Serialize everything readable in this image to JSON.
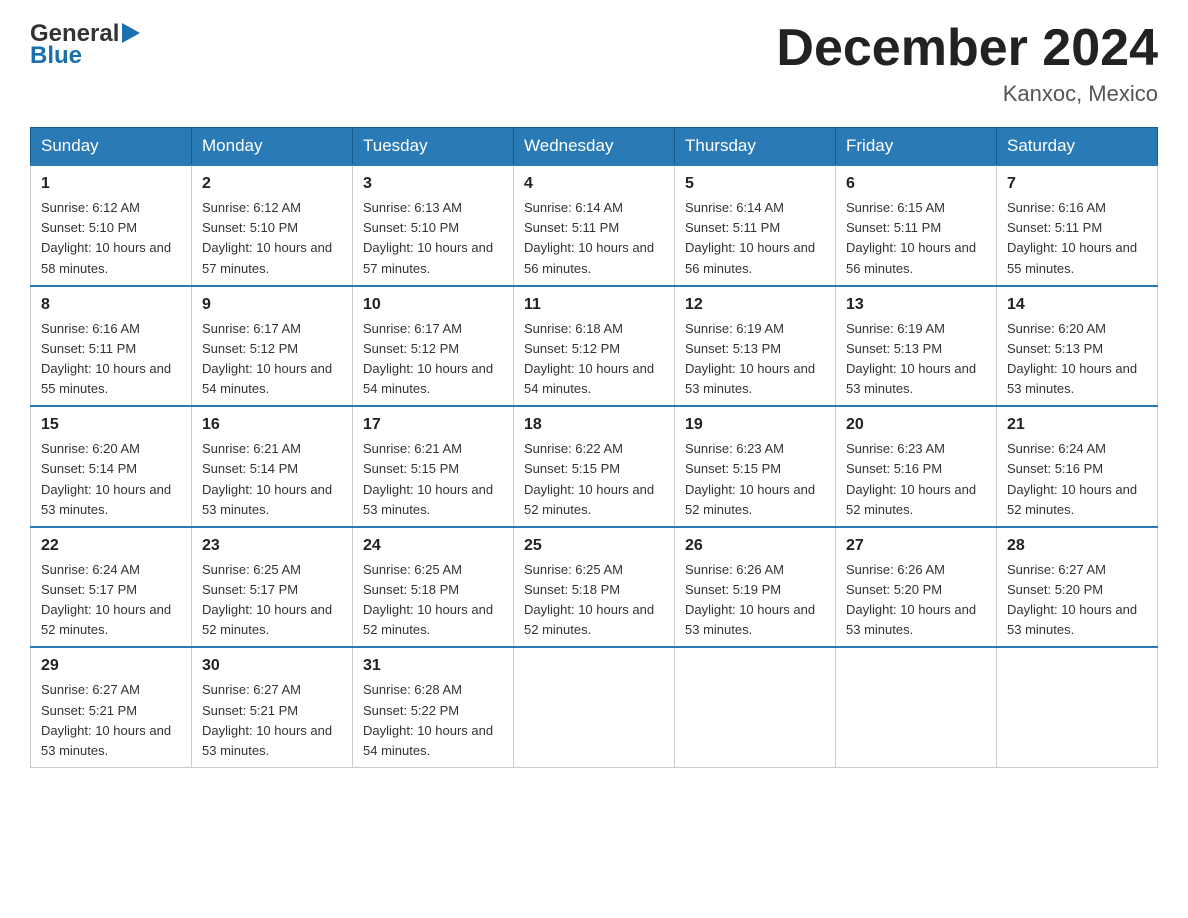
{
  "header": {
    "logo_general": "General",
    "logo_blue": "Blue",
    "month_title": "December 2024",
    "location": "Kanxoc, Mexico"
  },
  "days_of_week": [
    "Sunday",
    "Monday",
    "Tuesday",
    "Wednesday",
    "Thursday",
    "Friday",
    "Saturday"
  ],
  "weeks": [
    [
      {
        "day": "1",
        "sunrise": "6:12 AM",
        "sunset": "5:10 PM",
        "daylight": "10 hours and 58 minutes."
      },
      {
        "day": "2",
        "sunrise": "6:12 AM",
        "sunset": "5:10 PM",
        "daylight": "10 hours and 57 minutes."
      },
      {
        "day": "3",
        "sunrise": "6:13 AM",
        "sunset": "5:10 PM",
        "daylight": "10 hours and 57 minutes."
      },
      {
        "day": "4",
        "sunrise": "6:14 AM",
        "sunset": "5:11 PM",
        "daylight": "10 hours and 56 minutes."
      },
      {
        "day": "5",
        "sunrise": "6:14 AM",
        "sunset": "5:11 PM",
        "daylight": "10 hours and 56 minutes."
      },
      {
        "day": "6",
        "sunrise": "6:15 AM",
        "sunset": "5:11 PM",
        "daylight": "10 hours and 56 minutes."
      },
      {
        "day": "7",
        "sunrise": "6:16 AM",
        "sunset": "5:11 PM",
        "daylight": "10 hours and 55 minutes."
      }
    ],
    [
      {
        "day": "8",
        "sunrise": "6:16 AM",
        "sunset": "5:11 PM",
        "daylight": "10 hours and 55 minutes."
      },
      {
        "day": "9",
        "sunrise": "6:17 AM",
        "sunset": "5:12 PM",
        "daylight": "10 hours and 54 minutes."
      },
      {
        "day": "10",
        "sunrise": "6:17 AM",
        "sunset": "5:12 PM",
        "daylight": "10 hours and 54 minutes."
      },
      {
        "day": "11",
        "sunrise": "6:18 AM",
        "sunset": "5:12 PM",
        "daylight": "10 hours and 54 minutes."
      },
      {
        "day": "12",
        "sunrise": "6:19 AM",
        "sunset": "5:13 PM",
        "daylight": "10 hours and 53 minutes."
      },
      {
        "day": "13",
        "sunrise": "6:19 AM",
        "sunset": "5:13 PM",
        "daylight": "10 hours and 53 minutes."
      },
      {
        "day": "14",
        "sunrise": "6:20 AM",
        "sunset": "5:13 PM",
        "daylight": "10 hours and 53 minutes."
      }
    ],
    [
      {
        "day": "15",
        "sunrise": "6:20 AM",
        "sunset": "5:14 PM",
        "daylight": "10 hours and 53 minutes."
      },
      {
        "day": "16",
        "sunrise": "6:21 AM",
        "sunset": "5:14 PM",
        "daylight": "10 hours and 53 minutes."
      },
      {
        "day": "17",
        "sunrise": "6:21 AM",
        "sunset": "5:15 PM",
        "daylight": "10 hours and 53 minutes."
      },
      {
        "day": "18",
        "sunrise": "6:22 AM",
        "sunset": "5:15 PM",
        "daylight": "10 hours and 52 minutes."
      },
      {
        "day": "19",
        "sunrise": "6:23 AM",
        "sunset": "5:15 PM",
        "daylight": "10 hours and 52 minutes."
      },
      {
        "day": "20",
        "sunrise": "6:23 AM",
        "sunset": "5:16 PM",
        "daylight": "10 hours and 52 minutes."
      },
      {
        "day": "21",
        "sunrise": "6:24 AM",
        "sunset": "5:16 PM",
        "daylight": "10 hours and 52 minutes."
      }
    ],
    [
      {
        "day": "22",
        "sunrise": "6:24 AM",
        "sunset": "5:17 PM",
        "daylight": "10 hours and 52 minutes."
      },
      {
        "day": "23",
        "sunrise": "6:25 AM",
        "sunset": "5:17 PM",
        "daylight": "10 hours and 52 minutes."
      },
      {
        "day": "24",
        "sunrise": "6:25 AM",
        "sunset": "5:18 PM",
        "daylight": "10 hours and 52 minutes."
      },
      {
        "day": "25",
        "sunrise": "6:25 AM",
        "sunset": "5:18 PM",
        "daylight": "10 hours and 52 minutes."
      },
      {
        "day": "26",
        "sunrise": "6:26 AM",
        "sunset": "5:19 PM",
        "daylight": "10 hours and 53 minutes."
      },
      {
        "day": "27",
        "sunrise": "6:26 AM",
        "sunset": "5:20 PM",
        "daylight": "10 hours and 53 minutes."
      },
      {
        "day": "28",
        "sunrise": "6:27 AM",
        "sunset": "5:20 PM",
        "daylight": "10 hours and 53 minutes."
      }
    ],
    [
      {
        "day": "29",
        "sunrise": "6:27 AM",
        "sunset": "5:21 PM",
        "daylight": "10 hours and 53 minutes."
      },
      {
        "day": "30",
        "sunrise": "6:27 AM",
        "sunset": "5:21 PM",
        "daylight": "10 hours and 53 minutes."
      },
      {
        "day": "31",
        "sunrise": "6:28 AM",
        "sunset": "5:22 PM",
        "daylight": "10 hours and 54 minutes."
      },
      null,
      null,
      null,
      null
    ]
  ]
}
